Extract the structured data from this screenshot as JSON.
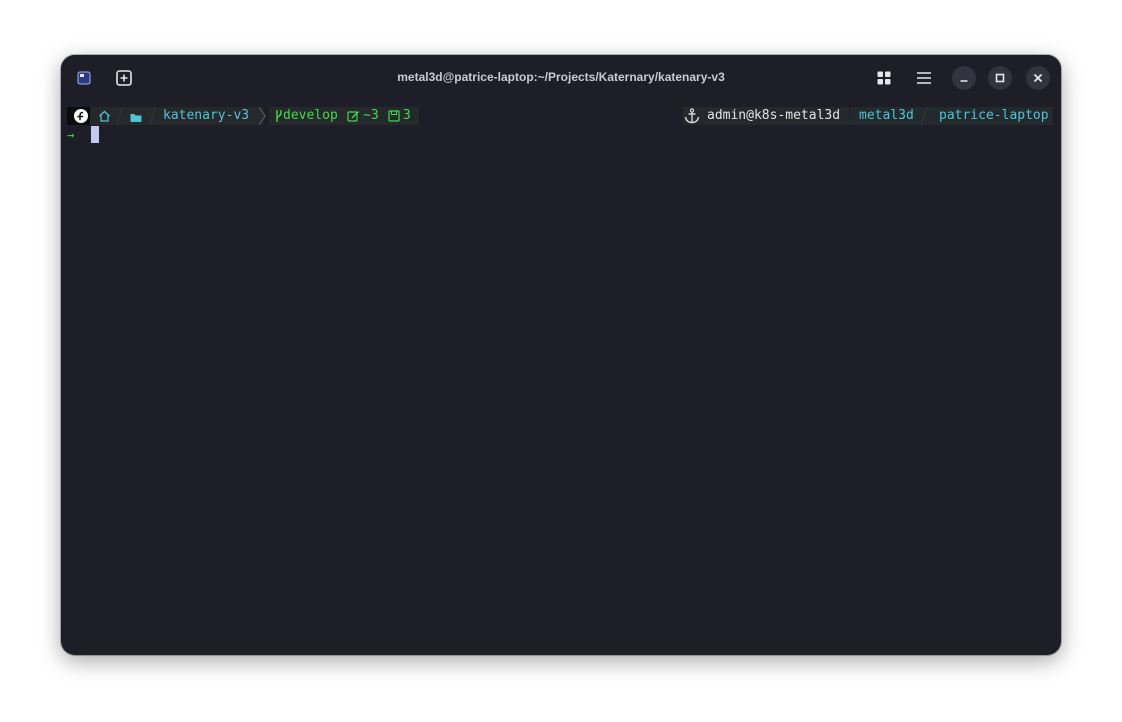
{
  "window": {
    "title": "metal3d@patrice-laptop:~/Projects/Katernary/katenary-v3"
  },
  "toolbar": {
    "app_icon": "terminal-app-icon",
    "new_tab_icon": "plus-square-icon",
    "view_icon": "grid-icon",
    "menu_icon": "hamburger-menu-icon",
    "minimize_icon": "minimize-icon",
    "maximize_icon": "maximize-icon",
    "close_icon": "close-icon"
  },
  "prompt": {
    "os_icon": "fedora-icon",
    "home_icon": "home-icon",
    "folder_icon": "folder-icon",
    "directory": "katenary-v3",
    "branch_icon": "git-branch-icon",
    "branch": "develop",
    "modified_icon": "edit-icon",
    "modified": "~3",
    "stash_icon": "save-icon",
    "stash": "3",
    "k8s_icon": "anchor-icon",
    "k8s_context": "admin@k8s-metal3d",
    "user": "metal3d",
    "host": "patrice-laptop",
    "arrow": "→"
  },
  "colors": {
    "background": "#1e1e28",
    "segment_bg": "#26272a",
    "cyan": "#4fc4d6",
    "green": "#3ddc4a",
    "cursor": "#c7c8f0"
  }
}
